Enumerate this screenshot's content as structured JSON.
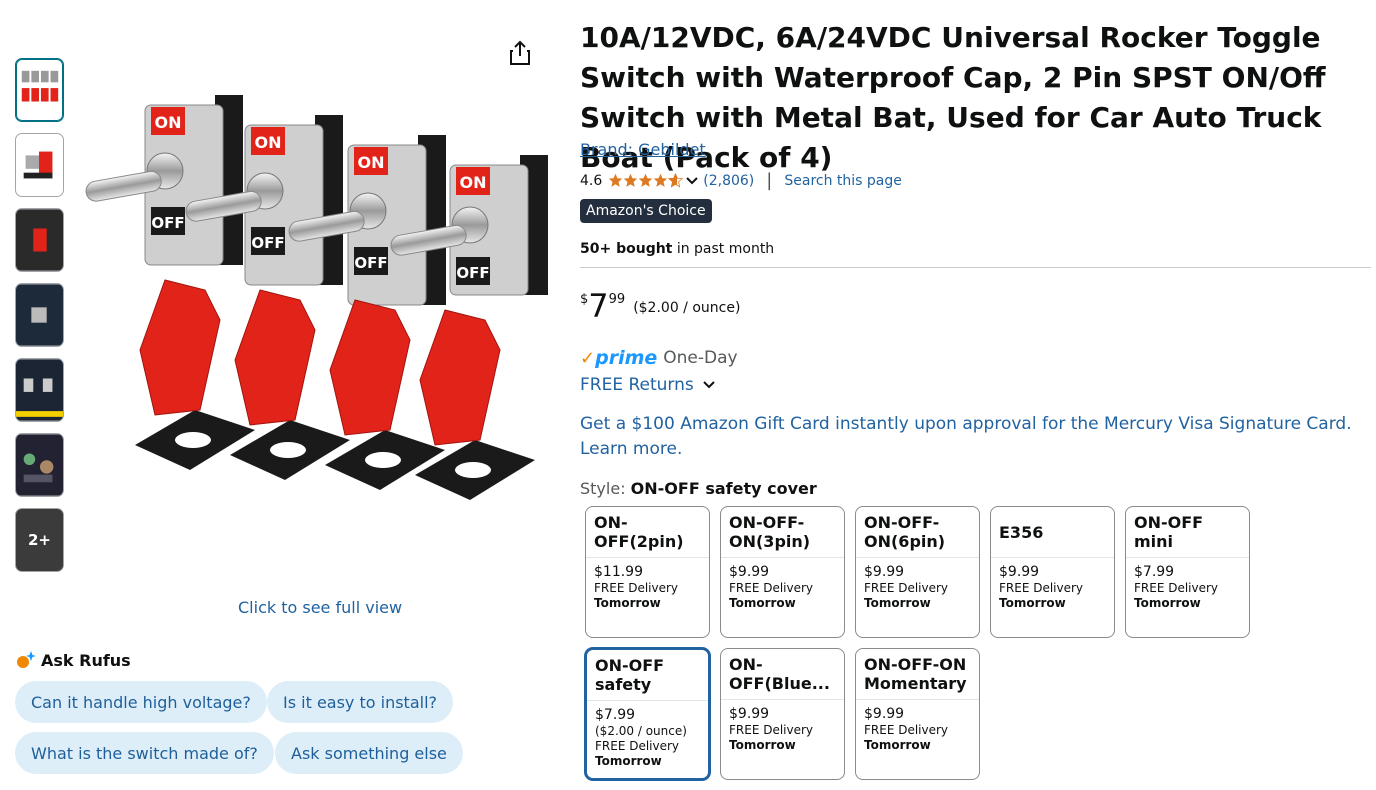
{
  "thumbnails": [
    {
      "name": "thumbnail-1"
    },
    {
      "name": "thumbnail-2"
    },
    {
      "name": "thumbnail-3"
    },
    {
      "name": "thumbnail-4"
    },
    {
      "name": "thumbnail-5"
    },
    {
      "name": "thumbnail-6"
    }
  ],
  "more_thumbnails_label": "2+",
  "image": {
    "click_full_view": "Click to see full view",
    "switch_on_label": "ON",
    "switch_off_label": "OFF",
    "switch_brand": "Gebildet"
  },
  "rufus": {
    "title": "Ask Rufus",
    "chips": [
      "Can it handle high voltage?",
      "Is it easy to install?",
      "What is the switch made of?",
      "Ask something else"
    ]
  },
  "product": {
    "title": "10A/12VDC, 6A/24VDC Universal Rocker Toggle Switch with Waterproof Cap, 2 Pin SPST ON/Off Switch with Metal Bat, Used for Car Auto Truck Boat (Pack of 4)",
    "brand": "Brand: Gebildet",
    "rating": "4.6",
    "rating_count": "(2,806)",
    "search_page": "Search this page",
    "badge": "Amazon's Choice",
    "bought_bold": "50+ bought",
    "bought_rest": " in past month",
    "price_symbol": "$",
    "price_whole": "7",
    "price_fraction": "99",
    "price_unit": "($2.00 / ounce)",
    "prime_word": "prime",
    "prime_speed": "One-Day",
    "returns": "FREE Returns",
    "gift_card": "Get a $100 Amazon Gift Card instantly upon approval for the Mercury Visa Signature Card. Learn more."
  },
  "style": {
    "label": "Style: ",
    "selected": "ON-OFF safety cover",
    "options": [
      {
        "name": "ON-OFF(2pin)",
        "price": "$11.99",
        "unit": "",
        "delivery": "FREE Delivery",
        "when": "Tomorrow"
      },
      {
        "name": "ON-OFF-ON(3pin)",
        "price": "$9.99",
        "unit": "",
        "delivery": "FREE Delivery",
        "when": "Tomorrow"
      },
      {
        "name": "ON-OFF-ON(6pin)",
        "price": "$9.99",
        "unit": "",
        "delivery": "FREE Delivery",
        "when": "Tomorrow"
      },
      {
        "name": "E356",
        "price": "$9.99",
        "unit": "",
        "delivery": "FREE Delivery",
        "when": "Tomorrow"
      },
      {
        "name": "ON-OFF mini",
        "price": "$7.99",
        "unit": "",
        "delivery": "FREE Delivery",
        "when": "Tomorrow"
      },
      {
        "name": "ON-OFF safety cover",
        "price": "$7.99",
        "unit": "($2.00 / ounce)",
        "delivery": "FREE Delivery",
        "when": "Tomorrow"
      },
      {
        "name": "ON-OFF(Blue...",
        "price": "$9.99",
        "unit": "",
        "delivery": "FREE Delivery",
        "when": "Tomorrow"
      },
      {
        "name": "ON-OFF-ON Momentary",
        "price": "$9.99",
        "unit": "",
        "delivery": "FREE Delivery",
        "when": "Tomorrow"
      }
    ]
  },
  "colors": {
    "link": "#2162a1",
    "star": "#de7921",
    "badge_bg": "#232f3e",
    "chip_bg": "#ddeef9",
    "prime_blue": "#1a98ff",
    "prime_check": "#f08804",
    "switch_red": "#e2231a"
  }
}
